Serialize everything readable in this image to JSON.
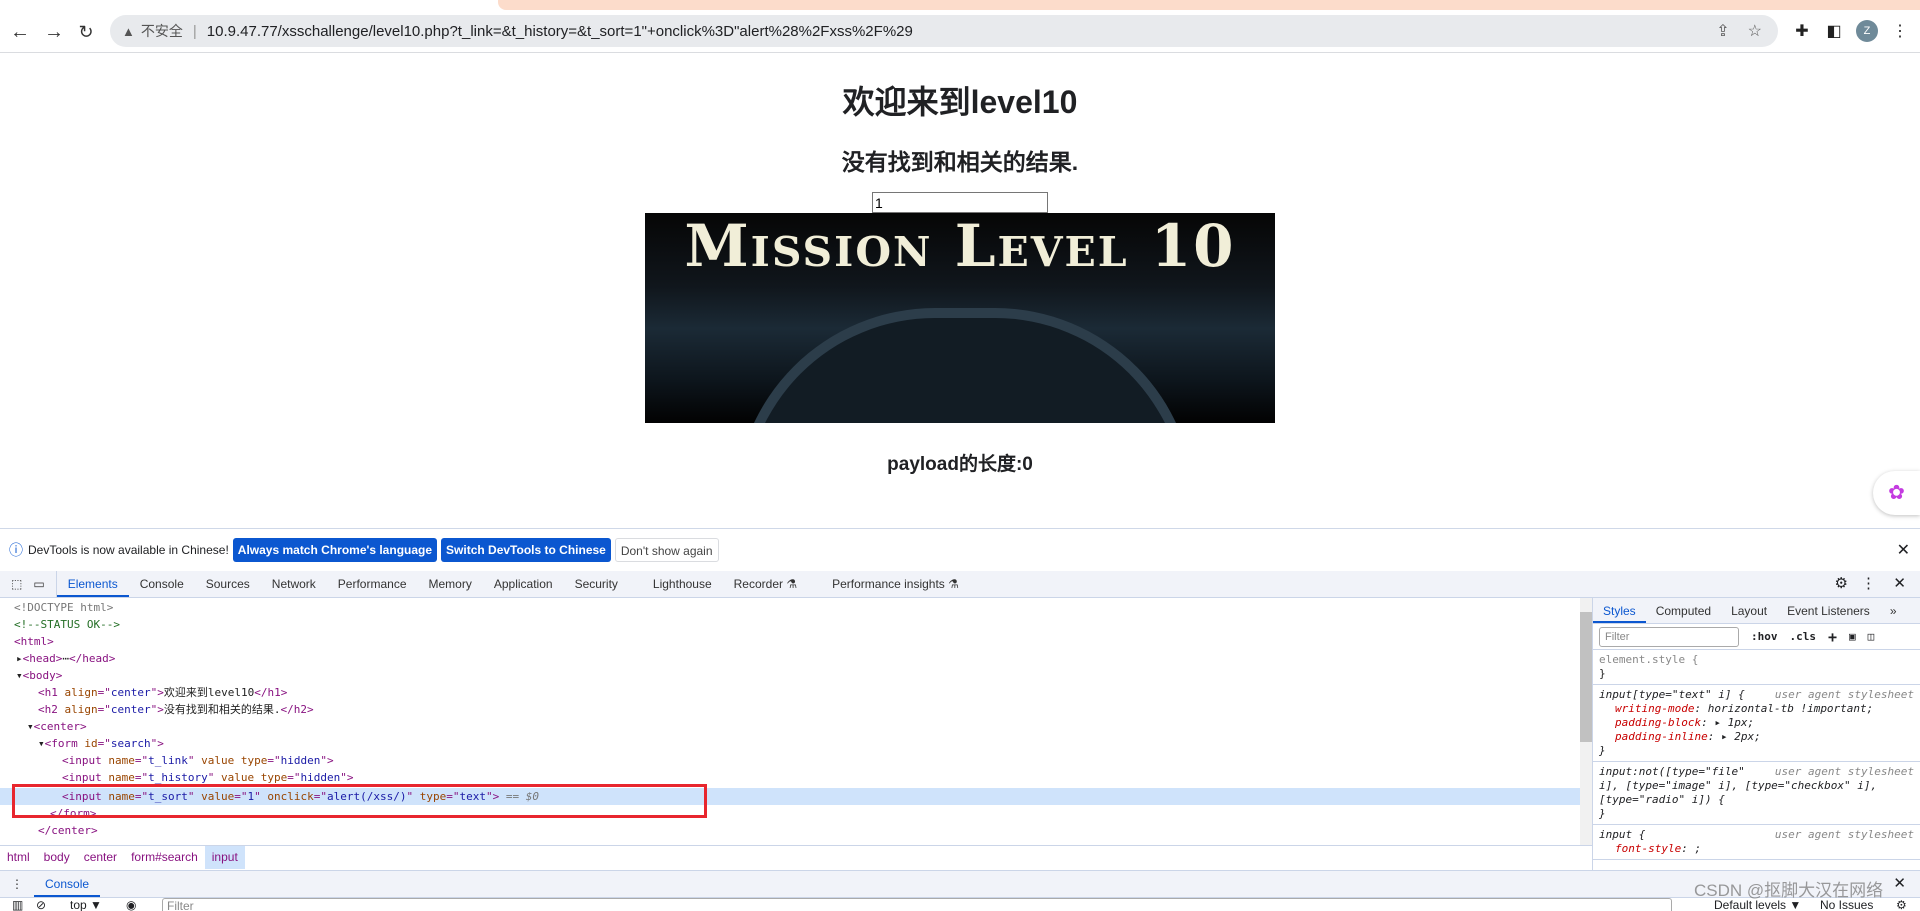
{
  "browser": {
    "nav": {
      "back_icon": "arrow-left",
      "forward_icon": "arrow-right",
      "reload_icon": "reload"
    },
    "omnibox": {
      "warning_icon": "warning-triangle",
      "security_label": "不安全",
      "url": "10.9.47.77/xsschallenge/level10.php?t_link=&t_history=&t_sort=1\"+onclick%3D\"alert%28%2Fxss%2F%29"
    },
    "profile_initial": "Z"
  },
  "page": {
    "h1": "欢迎来到level10",
    "h2": "没有找到和相关的结果.",
    "input_value": "1",
    "banner_text": "Mission Level 10",
    "payload_text": "payload的长度:0"
  },
  "infobar": {
    "message": "DevTools is now available in Chinese!",
    "btn_match": "Always match Chrome's language",
    "btn_switch": "Switch DevTools to Chinese",
    "btn_dismiss": "Don't show again"
  },
  "devtools": {
    "tabs": [
      "Elements",
      "Console",
      "Sources",
      "Network",
      "Performance",
      "Memory",
      "Application",
      "Security",
      "Lighthouse",
      "Recorder ⚗",
      "Performance insights ⚗"
    ],
    "dom": {
      "doctype": "<!DOCTYPE html>",
      "comment": "<!--STATUS OK-->",
      "h1_text": "欢迎来到level10",
      "h2_text": "没有找到和相关的结果.",
      "selected_suffix": " == $0"
    },
    "breadcrumbs": [
      "html",
      "body",
      "center",
      "form#search",
      "input"
    ],
    "styles_tabs": [
      "Styles",
      "Computed",
      "Layout",
      "Event Listeners",
      "»"
    ],
    "styles_filter_placeholder": "Filter",
    "styles_tools": [
      ":hov",
      ".cls"
    ],
    "user_agent_label": "user agent stylesheet",
    "drawer_tab": "Console",
    "console": {
      "context": "top ▼",
      "filter_placeholder": "Filter",
      "levels": "Default levels ▼",
      "issues": "No Issues"
    }
  },
  "watermark": "CSDN @抠脚大汉在网络"
}
